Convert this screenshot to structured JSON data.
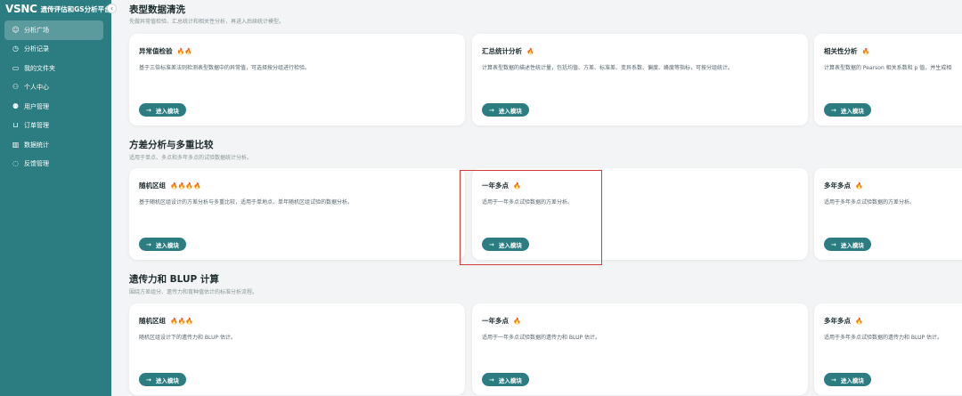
{
  "brand": {
    "logo": "VSNC",
    "title": "遗传评估和GS分析平台"
  },
  "sidebar": {
    "collapse_icon": "‹",
    "items": [
      {
        "label": "分析广场",
        "icon": "plaza-icon",
        "glyph": "☺",
        "active": true
      },
      {
        "label": "分析记录",
        "icon": "history-icon",
        "glyph": "◷",
        "active": false
      },
      {
        "label": "我的文件夹",
        "icon": "folder-icon",
        "glyph": "▭",
        "active": false
      },
      {
        "label": "个人中心",
        "icon": "user-icon",
        "glyph": "⚇",
        "active": false
      },
      {
        "label": "用户管理",
        "icon": "users-icon",
        "glyph": "⚉",
        "active": false
      },
      {
        "label": "订单管理",
        "icon": "cart-icon",
        "glyph": "⊔",
        "active": false
      },
      {
        "label": "数据统计",
        "icon": "chart-icon",
        "glyph": "▥",
        "active": false
      },
      {
        "label": "反馈管理",
        "icon": "feedback-icon",
        "glyph": "◌",
        "active": false
      }
    ]
  },
  "sections": [
    {
      "title": "表型数据清洗",
      "desc": "先做异常值检验、汇总统计和相关性分析，再进入后续统计模型。",
      "cards": [
        {
          "title": "异常值检验",
          "flames": 2,
          "desc": "基于三倍标准差法则检测表型数据中的异常值，可选择按分组进行检验。",
          "button": "进入模块"
        },
        {
          "title": "汇总统计分析",
          "flames": 1,
          "desc": "计算表型数据的描述性统计量，包括均值、方差、标准差、变异系数、偏度、峰度等指标，可按分组统计。",
          "button": "进入模块"
        },
        {
          "title": "相关性分析",
          "flames": 1,
          "desc": "计算表型数据的 Pearson 相关系数和 p 值，并生成相",
          "button": "进入模块"
        }
      ]
    },
    {
      "title": "方差分析与多重比较",
      "desc": "适用于单点、多点和多年多点的试验数据统计分析。",
      "cards": [
        {
          "title": "随机区组",
          "flames": 4,
          "desc": "基于随机区组设计的方差分析与多重比较，适用于单地点、单年随机区组试验的数据分析。",
          "button": "进入模块"
        },
        {
          "title": "一年多点",
          "flames": 1,
          "desc": "适用于一年多点试验数据的方差分析。",
          "button": "进入模块"
        },
        {
          "title": "多年多点",
          "flames": 1,
          "desc": "适用于多年多点试验数据的方差分析。",
          "button": "进入模块"
        }
      ]
    },
    {
      "title": "遗传力和 BLUP 计算",
      "desc": "围绕方差组分、遗传力和育种值估计的标准分析流程。",
      "cards": [
        {
          "title": "随机区组",
          "flames": 3,
          "desc": "随机区组设计下的遗传力和 BLUP 估计。",
          "button": "进入模块"
        },
        {
          "title": "一年多点",
          "flames": 1,
          "desc": "适用于一年多点试验数据的遗传力和 BLUP 估计。",
          "button": "进入模块"
        },
        {
          "title": "多年多点",
          "flames": 1,
          "desc": "适用于多年多点试验数据的遗传力和 BLUP 估计。",
          "button": "进入模块"
        }
      ]
    }
  ],
  "colors": {
    "sidebar": "#2b7d81",
    "accent": "#2b7d81",
    "flame": "#e04b3f",
    "highlight": "#d43c3c"
  }
}
